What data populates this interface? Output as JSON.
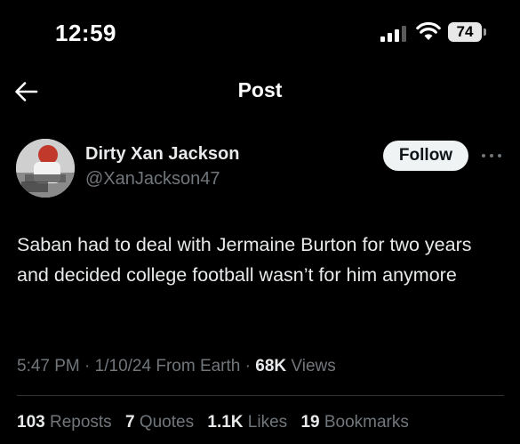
{
  "status_bar": {
    "time": "12:59",
    "battery": "74",
    "icons": [
      "cellular-signal-icon",
      "wifi-icon",
      "battery-icon"
    ]
  },
  "header": {
    "title": "Post",
    "back_icon": "back-arrow-icon"
  },
  "author": {
    "display_name": "Dirty Xan Jackson",
    "handle": "@XanJackson47"
  },
  "actions": {
    "follow_label": "Follow",
    "more_icon": "more-icon"
  },
  "post": {
    "text": "Saban had to deal with Jermaine Burton for two years and decided college football wasn’t for him anymore"
  },
  "meta": {
    "time": "5:47 PM",
    "sep1": " · ",
    "date": "1/10/24",
    "location": " From Earth",
    "sep2": " · ",
    "views_count": "68K",
    "views_label": " Views"
  },
  "stats": {
    "reposts_count": "103",
    "reposts_label": " Reposts",
    "quotes_count": "7",
    "quotes_label": " Quotes",
    "likes_count": "1.1K",
    "likes_label": " Likes",
    "bookmarks_count": "19",
    "bookmarks_label": " Bookmarks"
  },
  "colors": {
    "background": "#000000",
    "primary_text": "#e7e9ea",
    "secondary_text": "#71767b",
    "follow_bg": "#eff3f4",
    "divider": "#2f3336"
  }
}
